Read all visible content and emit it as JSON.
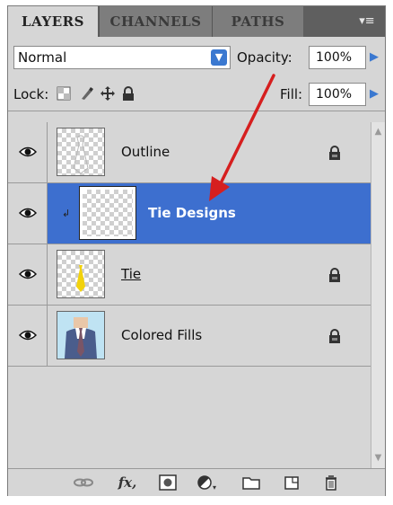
{
  "tabs": {
    "layers": "LAYERS",
    "channels": "CHANNELS",
    "paths": "PATHS"
  },
  "panel_menu_icon": "panel-menu-icon",
  "blend": {
    "mode": "Normal",
    "opacity_label": "Opacity:",
    "opacity_value": "100%"
  },
  "lock": {
    "label": "Lock:",
    "fill_label": "Fill:",
    "fill_value": "100%"
  },
  "layers": [
    {
      "name": "Outline",
      "locked": true,
      "selected": false
    },
    {
      "name": "Tie Designs",
      "locked": false,
      "selected": true,
      "clipped": true
    },
    {
      "name": "Tie",
      "locked": true,
      "selected": false
    },
    {
      "name": "Colored Fills",
      "locked": true,
      "selected": false
    }
  ],
  "bottom_icons": [
    "link-icon",
    "fx-icon",
    "mask-icon",
    "adjustment-icon",
    "folder-icon",
    "new-layer-icon",
    "trash-icon"
  ],
  "colors": {
    "panel_bg": "#d6d6d6",
    "selected_row": "#3d6fcf",
    "accent_blue": "#3a78d0",
    "annotation_arrow": "#d61f1f"
  }
}
